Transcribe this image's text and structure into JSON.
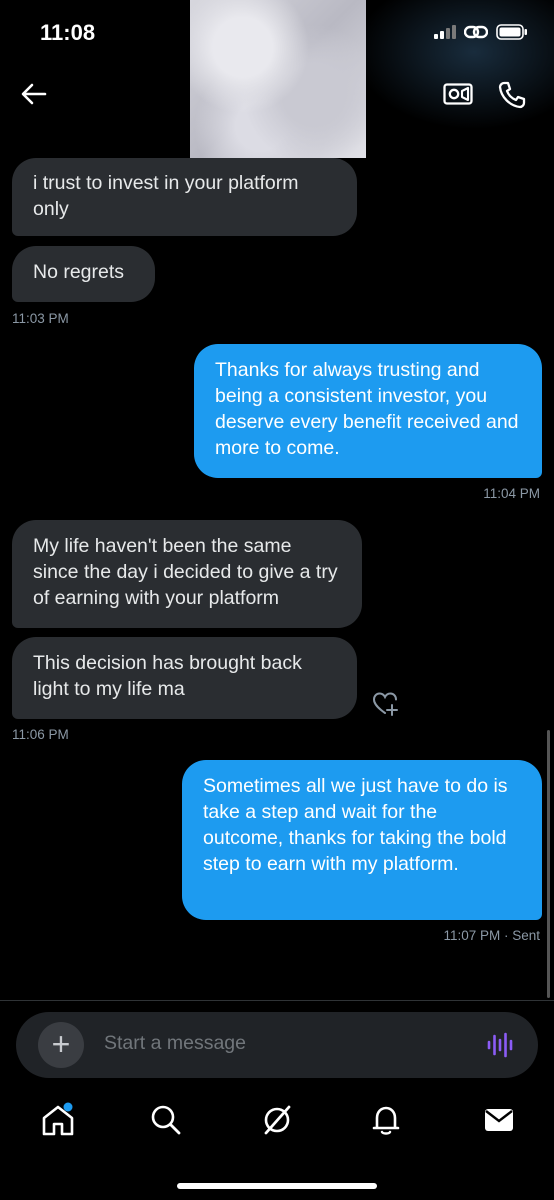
{
  "status_bar": {
    "time": "11:08"
  },
  "messages": [
    {
      "id": "m1",
      "direction": "in",
      "text": "i trust to invest in your platform only"
    },
    {
      "id": "m2",
      "direction": "in",
      "text": "No regrets"
    },
    {
      "id": "t1",
      "timestamp": "11:03 PM"
    },
    {
      "id": "m3",
      "direction": "out",
      "text": "Thanks for always trusting and being a consistent investor, you deserve every benefit received and more to come."
    },
    {
      "id": "t2",
      "timestamp": "11:04 PM"
    },
    {
      "id": "m4",
      "direction": "in",
      "text": "My life haven't been the same since the day i decided to give a try of earning with your platform"
    },
    {
      "id": "m5",
      "direction": "in",
      "text": "This decision has brought back light to my life ma"
    },
    {
      "id": "t3",
      "timestamp": "11:06 PM"
    },
    {
      "id": "m6",
      "direction": "out",
      "text": "Sometimes all we just have to do is take a step and wait for the outcome, thanks for taking the bold step to earn with my platform."
    },
    {
      "id": "t4",
      "timestamp": "11:07 PM · Sent"
    }
  ],
  "composer": {
    "placeholder": "Start a message"
  },
  "icons": {
    "back": "arrow-left-icon",
    "video": "video-call-icon",
    "phone": "phone-icon",
    "react": "heart-plus-icon",
    "voice": "voice-wave-icon",
    "nav": [
      "home-icon",
      "search-icon",
      "grok-icon",
      "notifications-icon",
      "messages-icon"
    ]
  },
  "colors": {
    "accent": "#1d9bf0",
    "incoming_bubble": "#2a2d31",
    "voice_purple": "#8b5cf6",
    "notification_dot": "#1d9bf0"
  }
}
